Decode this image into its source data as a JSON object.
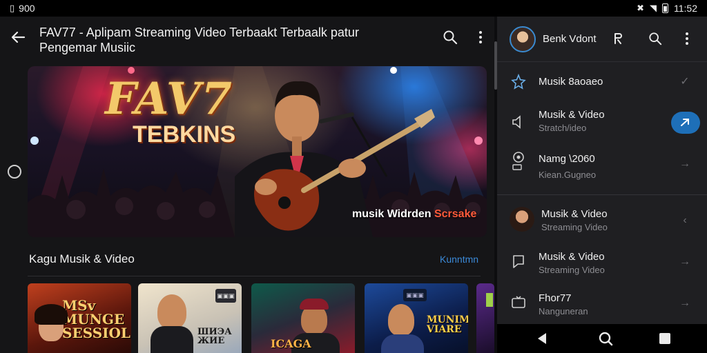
{
  "status_bar": {
    "left_text": "900",
    "time": "11:52"
  },
  "header": {
    "title": "FAV77 - Aplipam Streaming Video Terbaakt Terbaalk patur Pengemar Musiic"
  },
  "banner": {
    "logo": "FAV7",
    "subtitle": "TEBKINS",
    "caption_main": "musik Widrden ",
    "caption_accent": "Scrsake"
  },
  "section": {
    "title": "Kagu Musik & Video",
    "link": "Kunntmn"
  },
  "cards": [
    {
      "text": "MSv\nMUNGE\nSESSIOL",
      "colors": [
        "#b8321a",
        "#3a120a"
      ]
    },
    {
      "text": "ШИЭА\nЖИЕ",
      "badge": "▣▣▣",
      "colors": [
        "#e8d8c0",
        "#b9c7d6"
      ]
    },
    {
      "text": "ICAGA",
      "colors": [
        "#1b6b5c",
        "#7a1b2a"
      ]
    },
    {
      "text": "MUNIM\nVIARE",
      "badge": "▣▣▣",
      "colors": [
        "#1a3a7a",
        "#0b1a40"
      ]
    },
    {
      "text": "",
      "colors": [
        "#4a1d6a",
        "#1a0d2a"
      ]
    }
  ],
  "panel": {
    "profile_name": "Benk Vdont",
    "items": [
      {
        "title": "Musik 8aoaeo",
        "subtitle": "",
        "icon": "star-icon",
        "arrow": "✓"
      },
      {
        "title": "Musik & Video",
        "subtitle": "Stratch/ideo",
        "icon": "speaker-icon",
        "arrow": "→"
      },
      {
        "title": "Namg \\2060",
        "subtitle": "Kiean.Gugneo",
        "icon": "pin-icon",
        "arrow": "→"
      },
      {
        "title": "Musik & Video",
        "subtitle": "Streaming Video",
        "icon": "avatar-icon",
        "arrow": "‹"
      },
      {
        "title": "Musik & Video",
        "subtitle": "Streaming Video",
        "icon": "chat-icon",
        "arrow": "→"
      },
      {
        "title": "Fhor77",
        "subtitle": "Nanguneran",
        "icon": "tv-icon",
        "arrow": "→"
      }
    ]
  },
  "colors": {
    "accent": "#1e6fb8",
    "link": "#3b8ad8",
    "panel_bg": "#1f1f22",
    "main_bg": "#151517"
  }
}
